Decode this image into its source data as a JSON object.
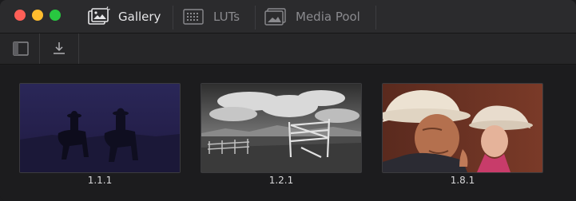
{
  "window": {
    "traffic_lights": {
      "close_color": "#fe5f57",
      "minimize_color": "#febc2e",
      "maximize_color": "#28c840"
    }
  },
  "tabs": [
    {
      "label": "Gallery",
      "icon": "gallery-icon",
      "active": true
    },
    {
      "label": "LUTs",
      "icon": "luts-icon",
      "active": false
    },
    {
      "label": "Media Pool",
      "icon": "media-pool-icon",
      "active": false
    }
  ],
  "toolbar": {
    "buttons": [
      {
        "icon": "sidebar-toggle-icon"
      },
      {
        "icon": "import-icon"
      }
    ]
  },
  "stills": [
    {
      "label": "1.1.1",
      "thumbnail": "two riders on horseback silhouetted at dusk, deep blue-purple tones"
    },
    {
      "label": "1.2.1",
      "thumbnail": "black-and-white landscape with wooden gate and cloudy sky"
    },
    {
      "label": "1.8.1",
      "thumbnail": "close-up of older man in cowboy hat with woman in cowboy hat"
    }
  ],
  "colors": {
    "tab_active_text": "#e6e6e8",
    "tab_inactive_text": "#8a8a8e",
    "label_text": "#d8d8da",
    "background": "#1c1c1e"
  }
}
